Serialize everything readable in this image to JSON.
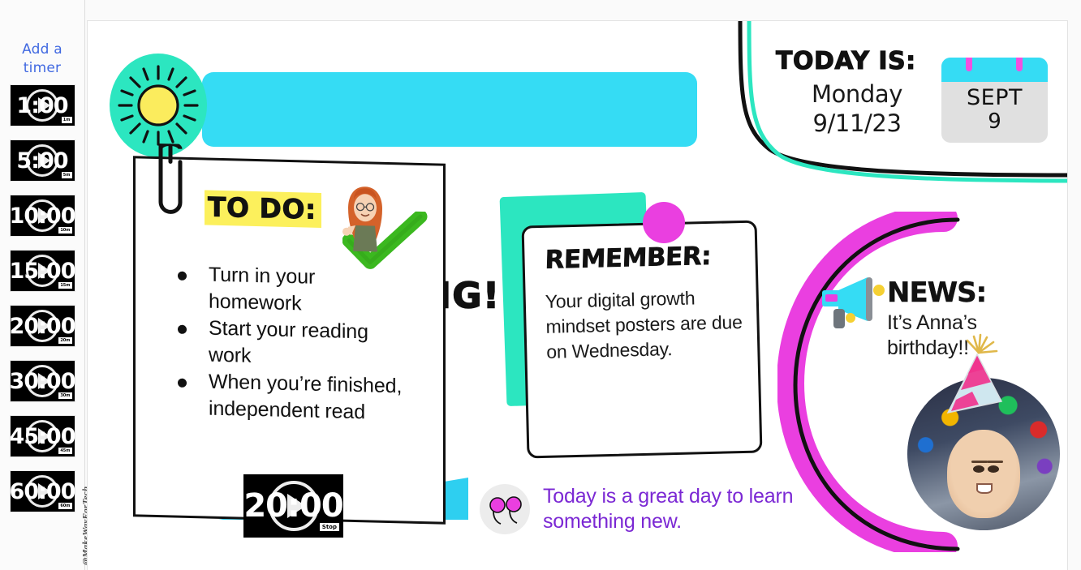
{
  "sidebar": {
    "add_timer_label": "Add a\ntimer",
    "timers": [
      {
        "display": "1:00",
        "duration_badge": "1m",
        "name": "timer-1-min"
      },
      {
        "display": "5:00",
        "duration_badge": "5m",
        "name": "timer-5-min"
      },
      {
        "display": "10:00",
        "duration_badge": "10m",
        "name": "timer-10-min"
      },
      {
        "display": "15:00",
        "duration_badge": "15m",
        "name": "timer-15-min"
      },
      {
        "display": "20:00",
        "duration_badge": "20m",
        "name": "timer-20-min"
      },
      {
        "display": "30:00",
        "duration_badge": "30m",
        "name": "timer-30-min"
      },
      {
        "display": "45:00",
        "duration_badge": "45m",
        "name": "timer-45-min"
      },
      {
        "display": "60:00",
        "duration_badge": "60m",
        "name": "timer-60-min"
      }
    ],
    "watermark": "@MakeWayForTech"
  },
  "header": {
    "greeting": "GOOD MORNING!",
    "sun_icon": "sun-icon"
  },
  "today": {
    "label": "TODAY IS:",
    "day": "Monday",
    "date": "9/11/23",
    "calendar_month": "SEPT",
    "calendar_day": "9",
    "calendar_icon": "calendar-icon"
  },
  "todo": {
    "heading": "TO DO:",
    "items": [
      "Turn in your homework",
      "Start your reading work",
      "When you’re finished, independent read"
    ],
    "paperclip_icon": "paperclip-icon",
    "check_icon": "green-check-icon",
    "avatar_icon": "teacher-avatar-icon",
    "timer": {
      "display": "20:00",
      "stop_label": "Stop"
    }
  },
  "remember": {
    "heading": "REMEMBER:",
    "body": "Your digital growth mindset posters are due on Wednesday.",
    "pin_icon": "push-pin-icon"
  },
  "news": {
    "heading": "NEWS:",
    "body": "It’s Anna’s birthday!!",
    "megaphone_icon": "megaphone-icon",
    "party_hat_icon": "party-hat-icon",
    "photo_alt": "birthday-student-photo"
  },
  "quote": {
    "text": "Today is a great day to learn something new.",
    "icon": "quotation-marks-icon"
  },
  "colors": {
    "cyan": "#35dcf4",
    "teal": "#2ce6c0",
    "magenta": "#ea3fe0",
    "yellow_highlight": "#fcf05c",
    "purple_text": "#7b28d4",
    "link_blue": "#4169e1",
    "green_check": "#3bb81f"
  }
}
